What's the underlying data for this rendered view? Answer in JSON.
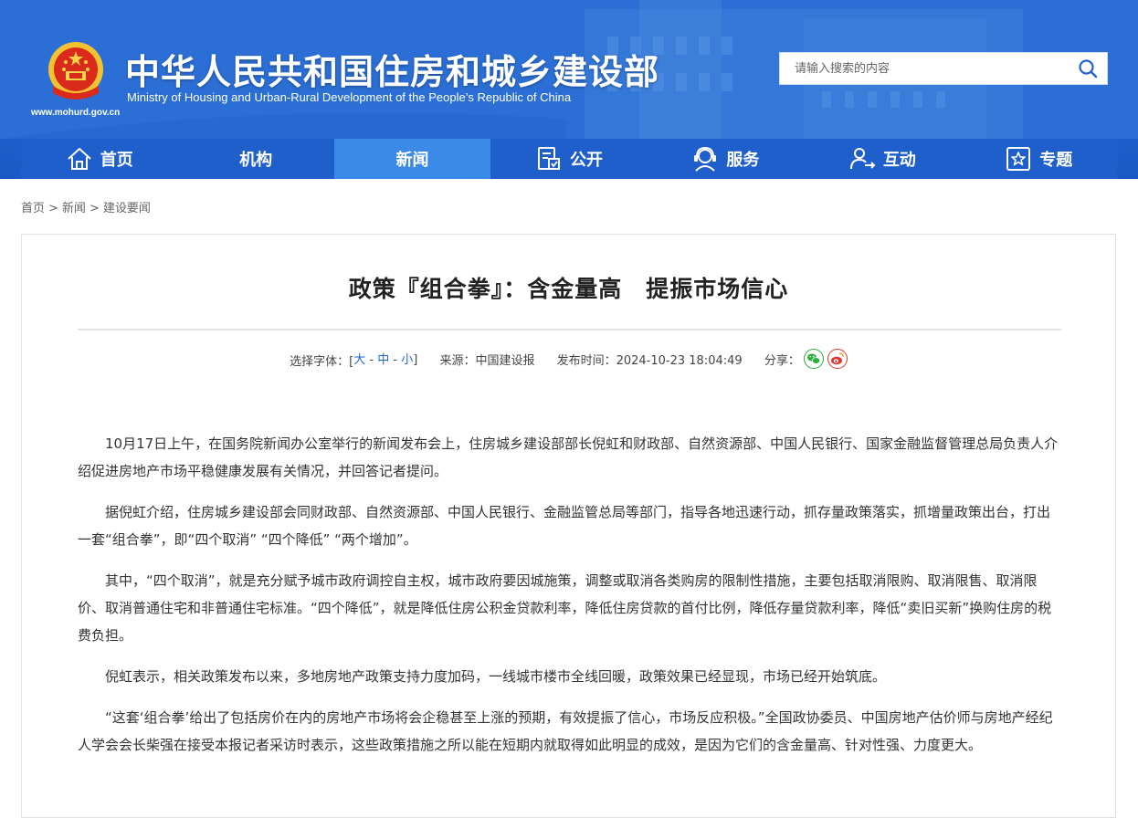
{
  "header": {
    "title": "中华人民共和国住房和城乡建设部",
    "subtitle": "Ministry of Housing and Urban-Rural Development of the People’s Republic of China",
    "url": "www.mohurd.gov.cn",
    "search_placeholder": "请输入搜索的内容"
  },
  "nav": {
    "items": [
      {
        "label": "首页",
        "icon": "home-icon"
      },
      {
        "label": "机构",
        "icon": ""
      },
      {
        "label": "新闻",
        "icon": "",
        "active": true
      },
      {
        "label": "公开",
        "icon": "document-icon"
      },
      {
        "label": "服务",
        "icon": "service-icon"
      },
      {
        "label": "互动",
        "icon": "interaction-icon"
      },
      {
        "label": "专题",
        "icon": "star-icon"
      }
    ]
  },
  "breadcrumb": [
    "首页",
    "新闻",
    "建设要闻"
  ],
  "article": {
    "title": "政策『组合拳』：含金量高　提振市场信心",
    "meta": {
      "font_label": "选择字体：[",
      "font_large": "大",
      "font_medium": "中",
      "font_small": "小",
      "font_close": "]",
      "source": "来源：中国建设报",
      "publish_time": "发布时间：2024-10-23 18:04:49",
      "share_label": "分享："
    },
    "paragraphs": [
      "10月17日上午，在国务院新闻办公室举行的新闻发布会上，住房城乡建设部部长倪虹和财政部、自然资源部、中国人民银行、国家金融监督管理总局负责人介绍促进房地产市场平稳健康发展有关情况，并回答记者提问。",
      "据倪虹介绍，住房城乡建设部会同财政部、自然资源部、中国人民银行、金融监管总局等部门，指导各地迅速行动，抓存量政策落实，抓增量政策出台，打出一套“组合拳”，即“四个取消” “四个降低” “两个增加”。",
      "其中，“四个取消”，就是充分赋予城市政府调控自主权，城市政府要因城施策，调整或取消各类购房的限制性措施，主要包括取消限购、取消限售、取消限价、取消普通住宅和非普通住宅标准。“四个降低”，就是降低住房公积金贷款利率，降低住房贷款的首付比例，降低存量贷款利率，降低“卖旧买新”换购住房的税费负担。",
      "倪虹表示，相关政策发布以来，多地房地产政策支持力度加码，一线城市楼市全线回暖，政策效果已经显现，市场已经开始筑底。",
      "“这套‘组合拳’给出了包括房价在内的房地产市场将会企稳甚至上涨的预期，有效提振了信心，市场反应积极。”全国政协委员、中国房地产估价师与房地产经纪人学会会长柴强在接受本报记者采访时表示，这些政策措施之所以能在短期内就取得如此明显的成效，是因为它们的含金量高、针对性强、力度更大。"
    ]
  },
  "colors": {
    "header_blue": "#1f63cf",
    "nav_active": "#3b8ae8",
    "link_blue": "#1e63d0",
    "wechat_green": "#2bae3d",
    "weibo_red": "#e0342d"
  }
}
